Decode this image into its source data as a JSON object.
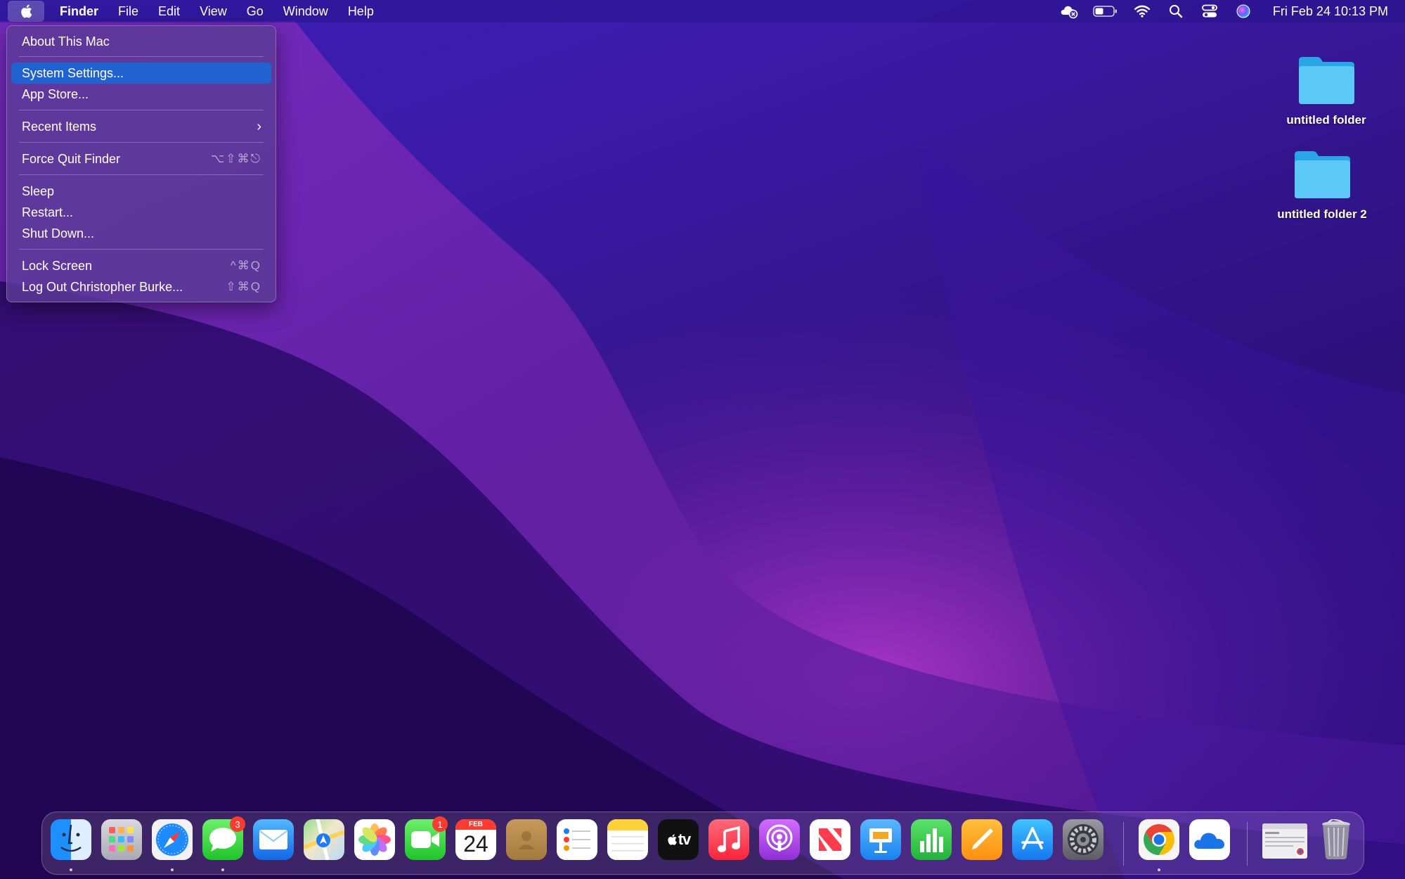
{
  "menubar": {
    "app_name": "Finder",
    "menus": [
      "File",
      "Edit",
      "View",
      "Go",
      "Window",
      "Help"
    ],
    "clock": "Fri Feb 24  10:13 PM",
    "status_icons": [
      "icloud-error-icon",
      "battery-icon",
      "wifi-icon",
      "spotlight-icon",
      "control-center-icon",
      "siri-icon"
    ]
  },
  "apple_menu": {
    "items": [
      {
        "label": "About This Mac"
      },
      {
        "label": "System Settings...",
        "selected": true
      },
      {
        "label": "App Store..."
      },
      {
        "label": "Recent Items",
        "submenu": true
      },
      {
        "label": "Force Quit Finder",
        "shortcut": "⌥⇧⌘⎋"
      },
      {
        "label": "Sleep"
      },
      {
        "label": "Restart..."
      },
      {
        "label": "Shut Down..."
      },
      {
        "label": "Lock Screen",
        "shortcut": "^⌘Q"
      },
      {
        "label": "Log Out Christopher Burke...",
        "shortcut": "⇧⌘Q"
      }
    ],
    "chevron": "›"
  },
  "desktop": {
    "items": [
      {
        "label": "untitled folder"
      },
      {
        "label": "untitled folder 2"
      }
    ]
  },
  "dock": {
    "apps": [
      {
        "name": "Finder",
        "icon": "finder-icon",
        "running": true
      },
      {
        "name": "Launchpad",
        "icon": "launchpad-icon"
      },
      {
        "name": "Safari",
        "icon": "safari-icon",
        "running": true
      },
      {
        "name": "Messages",
        "icon": "messages-icon",
        "badge": "3",
        "running": true
      },
      {
        "name": "Mail",
        "icon": "mail-icon"
      },
      {
        "name": "Maps",
        "icon": "maps-icon"
      },
      {
        "name": "Photos",
        "icon": "photos-icon"
      },
      {
        "name": "FaceTime",
        "icon": "facetime-icon",
        "badge": "1"
      },
      {
        "name": "Calendar",
        "icon": "calendar-icon",
        "month": "FEB",
        "day": "24"
      },
      {
        "name": "Contacts",
        "icon": "contacts-icon"
      },
      {
        "name": "Reminders",
        "icon": "reminders-icon"
      },
      {
        "name": "Notes",
        "icon": "notes-icon"
      },
      {
        "name": "TV",
        "icon": "apple-tv-icon",
        "text": "tv"
      },
      {
        "name": "Music",
        "icon": "music-icon"
      },
      {
        "name": "Podcasts",
        "icon": "podcasts-icon"
      },
      {
        "name": "News",
        "icon": "news-icon"
      },
      {
        "name": "Keynote",
        "icon": "keynote-icon"
      },
      {
        "name": "Numbers",
        "icon": "numbers-icon"
      },
      {
        "name": "Pages",
        "icon": "pages-icon"
      },
      {
        "name": "App Store",
        "icon": "app-store-icon"
      },
      {
        "name": "System Settings",
        "icon": "system-settings-icon"
      },
      {
        "name": "Google Chrome",
        "icon": "chrome-icon",
        "running": true
      },
      {
        "name": "OneDrive",
        "icon": "onedrive-icon"
      },
      {
        "name": "Recent Window",
        "icon": "window-thumbnail-icon"
      },
      {
        "name": "Trash",
        "icon": "trash-icon"
      }
    ]
  }
}
